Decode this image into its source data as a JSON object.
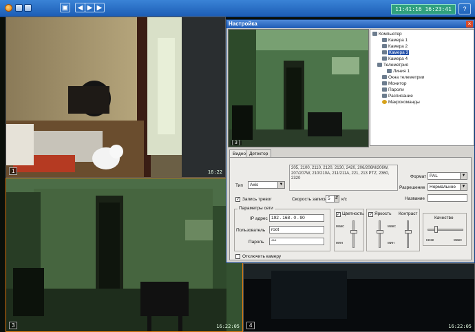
{
  "toolbar": {
    "clock": "11:41:16  16:23:41",
    "help_icon": "?"
  },
  "cameras": [
    {
      "label": "1",
      "time": "16:22"
    },
    {
      "label": "3",
      "time": "16:22:05"
    },
    {
      "label": "4",
      "time": "16:22:05"
    }
  ],
  "settings": {
    "title": "Настройка",
    "close": "×",
    "preview_label": "[ 3 ]",
    "tree": {
      "root": "Компьютер",
      "cameras": [
        "Камера 1",
        "Камера 2",
        "Камера 3",
        "Камера 4"
      ],
      "telemetry": "Телеметрия",
      "line": "Линия 1",
      "telemetry_windows": "Окна телеметрии",
      "monitor": "Монитор",
      "passwords": "Пароли",
      "schedule": "Расписание",
      "macros": "Макрокоманды",
      "selected": "Камера 3"
    },
    "tabs": [
      "Видео",
      "Детектор"
    ],
    "type_label": "Тип",
    "type_value": "Axis",
    "models_text": "205, 2100, 2110, 2120, 2130, 2420, 206/206M/206W, 207/207W, 210/210A, 211/211A, 221, 213 PTZ, 2360, 2320",
    "format_label": "Формат",
    "format_value": "PAL",
    "resolution_label": "Разрешение",
    "resolution_value": "Нормальное",
    "name_label": "Название",
    "name_value": "",
    "record_alarm": "Запись тревог",
    "record_speed_label": "Скорость записи",
    "record_speed_value": "5",
    "record_speed_unit": "к/с",
    "net_group": "Параметры сети",
    "ip_label": "IP адрес",
    "ip_value": "192 . 168 . 0 . 90",
    "user_label": "Пользователь",
    "user_value": "root",
    "password_label": "Пароль",
    "password_value": "***",
    "chroma_label": "Цветность",
    "brightness_label": "Яркость",
    "contrast_label": "Контраст",
    "max_label": "макс",
    "min_label": "мин",
    "quality_label": "Качество",
    "low_label": "низк",
    "high_label": "макс",
    "disable_camera": "Отключить камеру",
    "check_mark": "✓"
  }
}
